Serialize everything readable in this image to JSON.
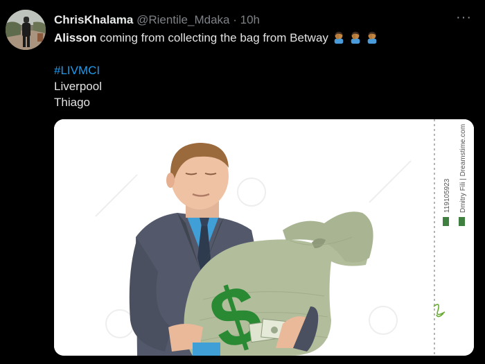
{
  "tweet": {
    "display_name": "ChrisKhalama",
    "handle": "@Rientile_Mdaka",
    "separator": "·",
    "time": "10h",
    "more_glyph": "···",
    "text_bold": "Alisson",
    "text_rest": "coming from collecting the bag from Betway",
    "emoji": "man-facepalming-emoji",
    "emoji_count": 3,
    "hashtag": "#LIVMCI",
    "line2": "Liverpool",
    "line3": "Thiago"
  },
  "media": {
    "watermark_id": "119105923",
    "watermark_credit": "Dmitry Fili | Dreamstime.com"
  },
  "colors": {
    "background": "#000000",
    "link": "#1d9bf0",
    "muted": "#7e8287",
    "bag": "#b1bc9b",
    "dollar": "#2a8a34"
  }
}
